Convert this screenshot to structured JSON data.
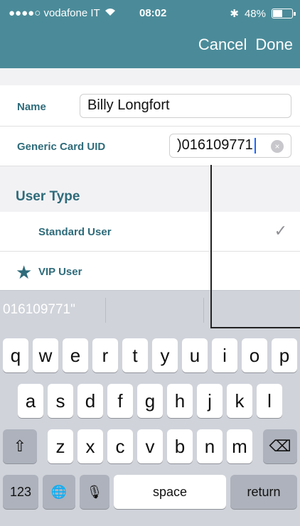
{
  "status_bar": {
    "carrier": "●●●●○ vodafone IT",
    "wifi_icon": "wifi-icon",
    "time": "08:02",
    "bluetooth": "✱",
    "battery": "48%"
  },
  "nav": {
    "cancel_label": "Cancel",
    "done_label": "Done"
  },
  "form": {
    "name_label": "Name",
    "name_value": "Billy Longfort",
    "uid_label": "Generic Card UID",
    "uid_value": ")016109771",
    "clear_glyph": "×"
  },
  "user_type": {
    "section_title": "User Type",
    "standard_label": "Standard User",
    "vip_label": "VIP User",
    "selected": "Standard User"
  },
  "predictive": {
    "suggestion": "016109771\""
  },
  "keyboard": {
    "row1": [
      "q",
      "w",
      "e",
      "r",
      "t",
      "y",
      "u",
      "i",
      "o",
      "p"
    ],
    "row2": [
      "a",
      "s",
      "d",
      "f",
      "g",
      "h",
      "j",
      "k",
      "l"
    ],
    "row3": [
      "z",
      "x",
      "c",
      "v",
      "b",
      "n",
      "m"
    ],
    "shift": "⇧",
    "backspace": "⌫",
    "numbers": "123",
    "globe": "🌐",
    "mic": "🎙",
    "space": "space",
    "return": "return"
  },
  "colors": {
    "header": "#4b8b99",
    "accent": "#2e6b7a"
  }
}
